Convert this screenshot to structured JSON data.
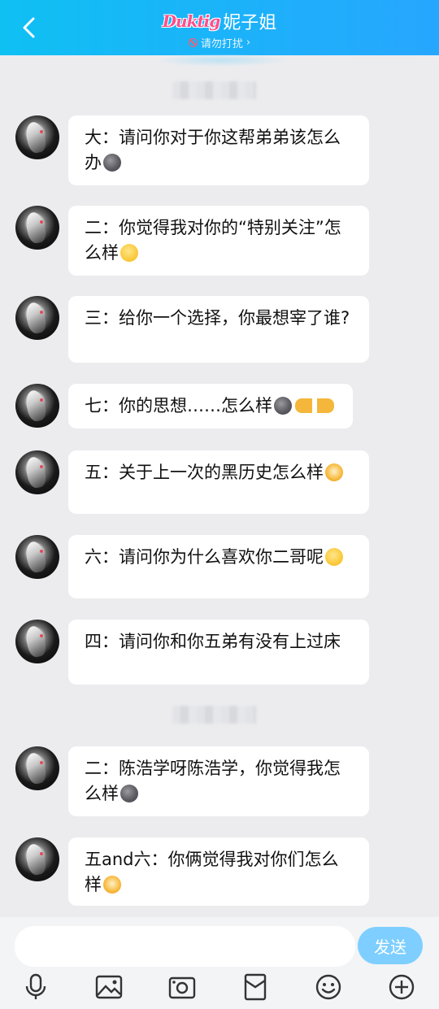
{
  "header": {
    "brand": "Duktig",
    "title": "妮子姐",
    "subtitle": "请勿打扰",
    "subtitle_arrow": "›"
  },
  "messages": [
    {
      "text": "大：请问你对于你这帮弟弟该怎么办",
      "emoji": "moon-face"
    },
    {
      "text": "二：你觉得我对你的“特别关注”怎么样",
      "emoji": "grin-face"
    },
    {
      "text": "三：给你一个选择，你最想宰了谁?",
      "emoji": ""
    },
    {
      "text": "七：你的思想……怎么样",
      "emoji": "moon-face pointing-hands"
    },
    {
      "text": "五：关于上一次的黑历史怎么样",
      "emoji": "tiger-face"
    },
    {
      "text": "六：请问你为什么喜欢你二哥呢",
      "emoji": "grin-face"
    },
    {
      "text": "四：请问你和你五弟有没有上过床",
      "emoji": ""
    },
    {
      "text": "二：陈浩学呀陈浩学，你觉得我怎么样",
      "emoji": "moon-face"
    },
    {
      "text": "五and六：你俩觉得我对你们怎么样",
      "emoji": "tiger-face"
    }
  ],
  "input": {
    "value": "",
    "send_label": "发送"
  },
  "toolbar": [
    "microphone-icon",
    "image-icon",
    "camera-icon",
    "red-packet-icon",
    "emoji-icon",
    "plus-icon"
  ],
  "colors": {
    "header_start": "#0fc0f3",
    "header_end": "#27a6ff",
    "send_button": "#7ecfff",
    "background": "#ececef"
  }
}
